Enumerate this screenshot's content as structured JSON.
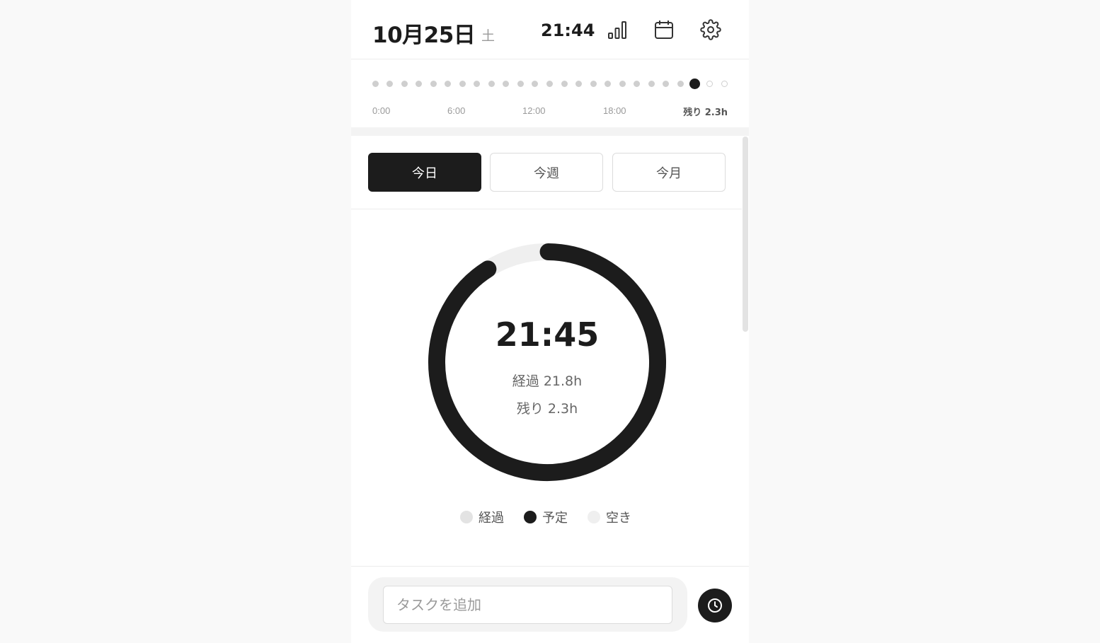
{
  "header": {
    "date": "10月25日",
    "weekday": "土",
    "time": "21:44",
    "icons": [
      "bar-chart-icon",
      "calendar-icon",
      "gear-icon"
    ]
  },
  "timeline": {
    "total_slots": 25,
    "current_index": 22,
    "ticks": [
      "0:00",
      "6:00",
      "12:00",
      "18:00"
    ],
    "remaining_label": "残り 2.3h"
  },
  "tabs": [
    {
      "label": "今日",
      "active": true
    },
    {
      "label": "今週",
      "active": false
    },
    {
      "label": "今月",
      "active": false
    }
  ],
  "summary": {
    "time": "21:45",
    "elapsed": "経過 21.8h",
    "remaining": "残り 2.3h"
  },
  "chart_data": {
    "type": "pie",
    "series": [
      {
        "name": "予定",
        "value": 21.8,
        "color": "#1c1c1c"
      },
      {
        "name": "空き",
        "value": 2.2,
        "color": "#efefef"
      }
    ],
    "total": 24
  },
  "legend": [
    {
      "label": "経過",
      "color": "#e3e3e3"
    },
    {
      "label": "予定",
      "color": "#1c1c1c"
    },
    {
      "label": "空き",
      "color": "#efefef"
    }
  ],
  "input": {
    "placeholder": "タスクを追加",
    "value": ""
  },
  "colors": {
    "primary": "#1c1c1c",
    "muted": "#9a9a9a"
  }
}
